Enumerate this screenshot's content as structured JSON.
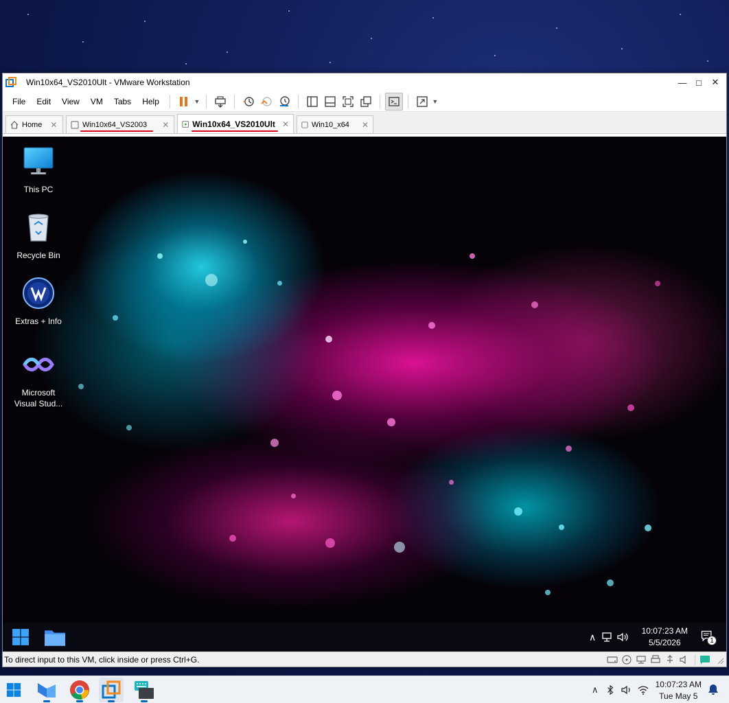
{
  "window": {
    "title": "Win10x64_VS2010Ult - VMware Workstation",
    "minimize": "—",
    "maximize": "□",
    "close": "✕"
  },
  "menu": [
    "File",
    "Edit",
    "View",
    "VM",
    "Tabs",
    "Help"
  ],
  "tabs": [
    {
      "label": "Home",
      "active": false
    },
    {
      "label": "Win10x64_VS2003",
      "active": false
    },
    {
      "label": "Win10x64_VS2010Ult",
      "active": true
    },
    {
      "label": "Win10_x64",
      "active": false
    }
  ],
  "tab_close": "✕",
  "desktop_icons": [
    {
      "label": "This PC"
    },
    {
      "label": "Recycle Bin"
    },
    {
      "label": "Extras + Info"
    },
    {
      "label": "Microsoft Visual Stud..."
    }
  ],
  "guest_clock": {
    "time": "10:07:23 AM",
    "date": "5/5/2026"
  },
  "guest_notifications": "1",
  "status": {
    "message": "To direct input to this VM, click inside or press Ctrl+G."
  },
  "host_clock": {
    "time": "10:07:23 AM",
    "date": "Tue May 5"
  },
  "colors": {
    "accent": "#0067c0",
    "pause": "#e8741c",
    "tab_underline": "#d9001b"
  }
}
